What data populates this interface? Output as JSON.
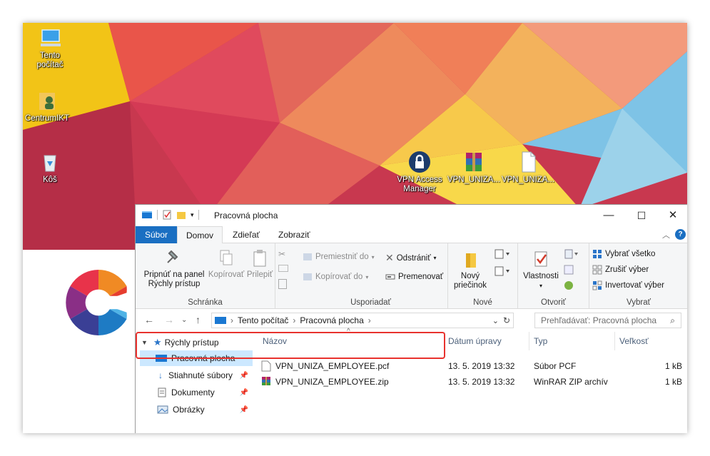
{
  "desktop": {
    "icons": [
      {
        "label_line1": "Tento",
        "label_line2": "počítač"
      },
      {
        "label_line1": "CentrumIKT"
      },
      {
        "label_line1": "Kôš"
      },
      {
        "label_line1": "VPN Access",
        "label_line2": "Manager"
      },
      {
        "label_line1": "VPN_UNIZA..."
      },
      {
        "label_line1": "VPN_UNIZA..."
      }
    ]
  },
  "window": {
    "title": "Pracovná plocha",
    "controls": {
      "minimize": "—",
      "maximize": "☐",
      "close": "✕"
    }
  },
  "tabs": [
    {
      "label": "Súbor"
    },
    {
      "label": "Domov"
    },
    {
      "label": "Zdieľať"
    },
    {
      "label": "Zobraziť"
    }
  ],
  "ribbon": {
    "clipboard": {
      "label": "Schránka",
      "pin_line1": "Pripnúť na panel",
      "pin_line2": "Rýchly prístup",
      "copy": "Kopírovať",
      "paste": "Prilepiť"
    },
    "organize": {
      "label": "Usporiadať",
      "move_to": "Premiestniť do",
      "copy_to": "Kopírovať do",
      "delete": "Odstrániť",
      "rename": "Premenovať"
    },
    "new": {
      "label": "Nové",
      "folder_line1": "Nový",
      "folder_line2": "priečinok"
    },
    "open": {
      "label": "Otvoriť",
      "properties": "Vlastnosti"
    },
    "select": {
      "label": "Vybrať",
      "all": "Vybrať všetko",
      "none": "Zrušiť výber",
      "invert": "Invertovať výber"
    }
  },
  "address": {
    "crumb1": "Tento počítač",
    "crumb2": "Pracovná plocha",
    "search_placeholder": "Prehľadávať: Pracovná plocha"
  },
  "navpane": {
    "quick_access": "Rýchly prístup",
    "items": [
      {
        "label": "Pracovná plocha"
      },
      {
        "label": "Stiahnuté súbory"
      },
      {
        "label": "Dokumenty"
      },
      {
        "label": "Obrázky"
      }
    ]
  },
  "columns": {
    "name": "Názov",
    "date": "Dátum úpravy",
    "type": "Typ",
    "size": "Veľkosť"
  },
  "files": [
    {
      "name": "VPN_UNIZA_EMPLOYEE.pcf",
      "date": "13. 5. 2019 13:32",
      "type": "Súbor PCF",
      "size": "1 kB"
    },
    {
      "name": "VPN_UNIZA_EMPLOYEE.zip",
      "date": "13. 5. 2019 13:32",
      "type": "WinRAR ZIP archív",
      "size": "1 kB"
    }
  ],
  "colors": {
    "file_tab": "#1a6fc2",
    "selection": "#cce8ff",
    "highlight": "#e8322e"
  }
}
